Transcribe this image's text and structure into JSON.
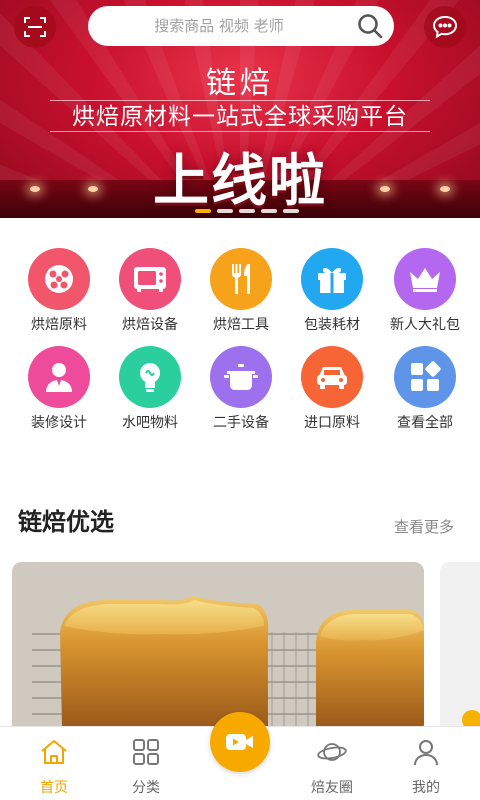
{
  "banner": {
    "brand": "链焙",
    "slogan": "烘焙原材料一站式全球采购平台",
    "headline": "上线啦",
    "slide_count": 5,
    "active_slide": 1
  },
  "search": {
    "placeholder": "搜索商品 视频 老师"
  },
  "categories": [
    {
      "label": "烘焙原料",
      "color": "#f2566a",
      "icon": "flour-icon"
    },
    {
      "label": "烘焙设备",
      "color": "#ef4f79",
      "icon": "oven-icon"
    },
    {
      "label": "烘焙工具",
      "color": "#f7a21b",
      "icon": "utensils-icon"
    },
    {
      "label": "包装耗材",
      "color": "#22a8f0",
      "icon": "gift-box-icon"
    },
    {
      "label": "新人大礼包",
      "color": "#b468f0",
      "icon": "crown-icon"
    },
    {
      "label": "装修设计",
      "color": "#ee4c9a",
      "icon": "person-icon"
    },
    {
      "label": "水吧物料",
      "color": "#2bcf9e",
      "icon": "lightbulb-icon"
    },
    {
      "label": "二手设备",
      "color": "#9d71ee",
      "icon": "pot-icon"
    },
    {
      "label": "进口原料",
      "color": "#f76436",
      "icon": "car-icon"
    },
    {
      "label": "查看全部",
      "color": "#5e95e8",
      "icon": "grid-icon"
    }
  ],
  "section": {
    "title": "链焙优选",
    "view_more": "查看更多"
  },
  "tabbar": {
    "home": "首页",
    "category": "分类",
    "community": "焙友圈",
    "mine": "我的"
  },
  "colors": {
    "accent": "#f6a400",
    "banner_red": "#c8102e"
  }
}
